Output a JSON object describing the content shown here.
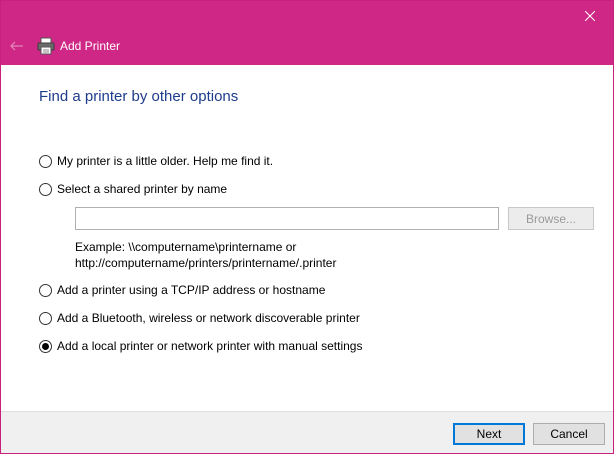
{
  "window": {
    "title": "Add Printer",
    "accent_color": "#cf2785"
  },
  "titlebar": {
    "back_icon": "back-arrow-icon",
    "app_icon": "printer-icon",
    "close_icon": "close-icon"
  },
  "main": {
    "heading": "Find a printer by other options",
    "options": [
      {
        "label": "My printer is a little older. Help me find it.",
        "selected": false
      },
      {
        "label": "Select a shared printer by name",
        "selected": false
      },
      {
        "label": "Add a printer using a TCP/IP address or hostname",
        "selected": false
      },
      {
        "label": "Add a Bluetooth, wireless or network discoverable printer",
        "selected": false
      },
      {
        "label": "Add a local printer or network printer with manual settings",
        "selected": true
      }
    ],
    "shared_printer": {
      "input_value": "",
      "browse_label": "Browse...",
      "example_line1": "Example: \\\\computername\\printername or",
      "example_line2": "http://computername/printers/printername/.printer"
    }
  },
  "footer": {
    "next_label": "Next",
    "cancel_label": "Cancel"
  }
}
